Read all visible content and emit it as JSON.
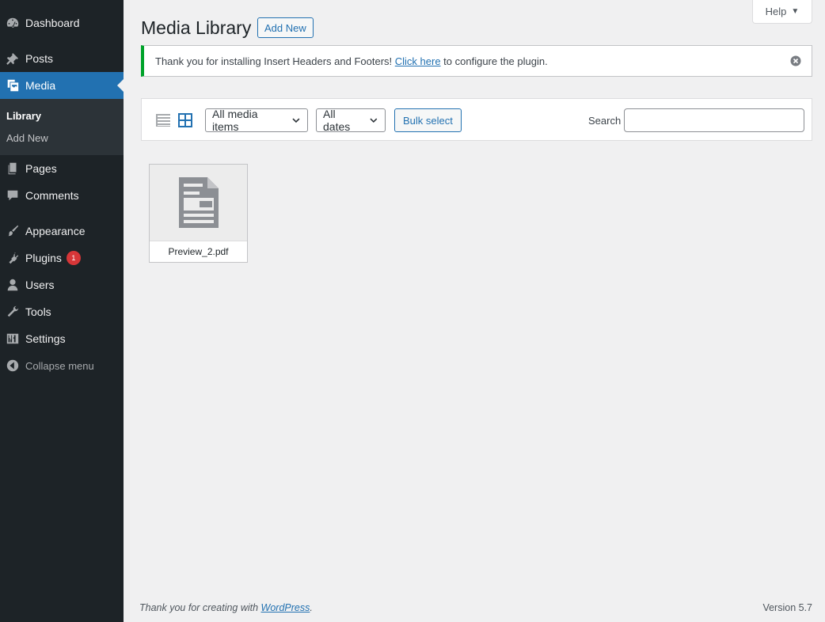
{
  "sidebar": {
    "dashboard": "Dashboard",
    "posts": "Posts",
    "media": "Media",
    "library": "Library",
    "add_new": "Add New",
    "pages": "Pages",
    "comments": "Comments",
    "appearance": "Appearance",
    "plugins": "Plugins",
    "plugins_badge": "1",
    "users": "Users",
    "tools": "Tools",
    "settings": "Settings",
    "collapse": "Collapse menu"
  },
  "header": {
    "title": "Media Library",
    "add_new": "Add New",
    "help": "Help"
  },
  "notice": {
    "text_before": "Thank you for installing Insert Headers and Footers! ",
    "link": "Click here",
    "text_after": " to configure the plugin."
  },
  "toolbar": {
    "filter_type": "All media items",
    "filter_date": "All dates",
    "bulk_select": "Bulk select",
    "search_label": "Search",
    "search_value": ""
  },
  "attachments": [
    {
      "filename": "Preview_2.pdf",
      "icon": "document-icon"
    }
  ],
  "footer": {
    "thanks_before": "Thank you for creating with ",
    "thanks_link": "WordPress",
    "thanks_after": ".",
    "version": "Version 5.7"
  },
  "colors": {
    "sidebar_bg": "#1d2327",
    "accent": "#2271b1",
    "notice_success": "#00a32a",
    "badge": "#d63638"
  }
}
